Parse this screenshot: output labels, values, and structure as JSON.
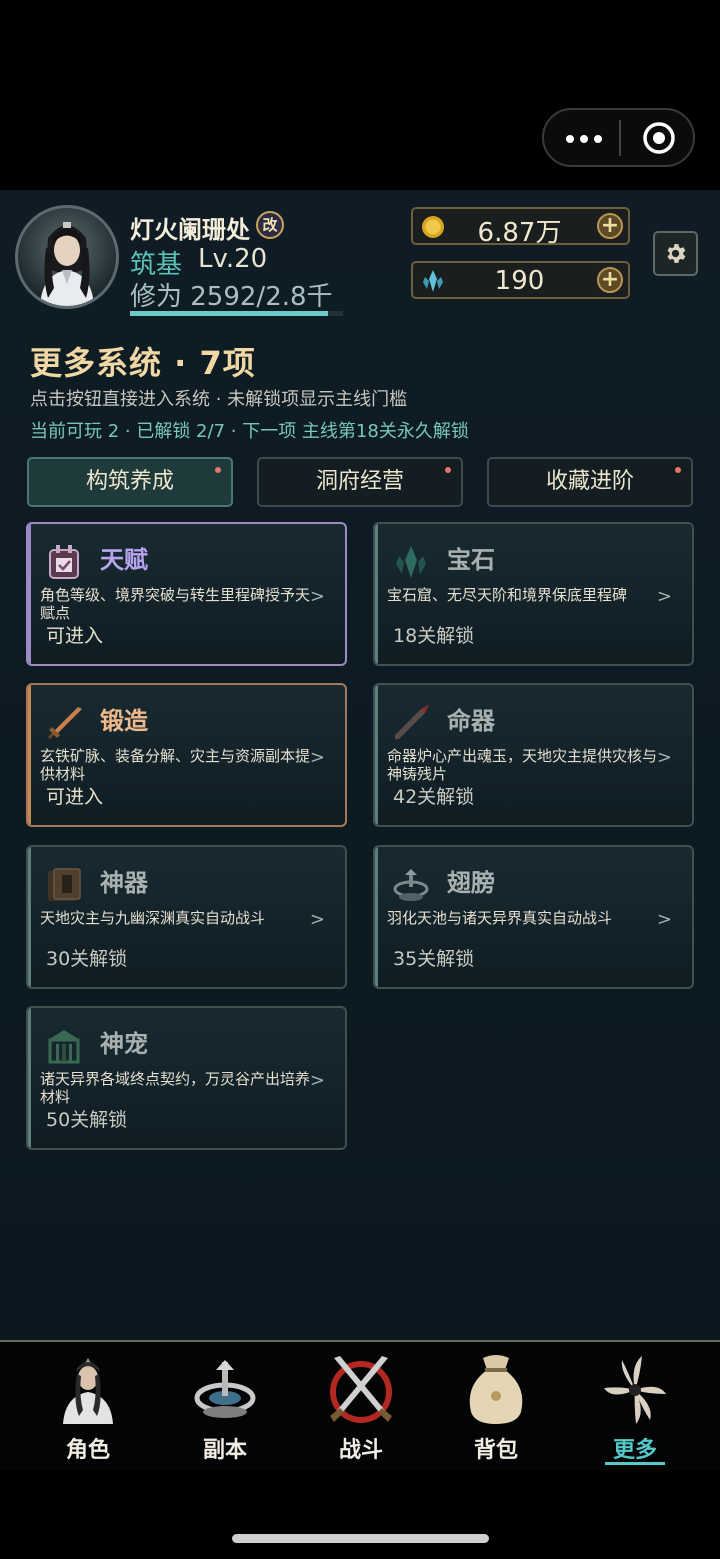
{
  "player": {
    "name": "灯火阑珊处",
    "rename_badge": "改",
    "realm": "筑基",
    "level": "Lv.20",
    "cultivation": "修为 2592/2.8千",
    "cultivation_progress": 0.93
  },
  "resources": {
    "gold": "6.87万",
    "spirit_crystal": "190",
    "plus": "+"
  },
  "header": {
    "title": "更多系统 · 7项",
    "subtitle": "点击按钮直接进入系统 · 未解锁项显示主线门槛",
    "status_line": "当前可玩 2 · 已解锁 2/7 · 下一项 主线第18关永久解锁"
  },
  "tabs": [
    {
      "label": "构筑养成",
      "active": true
    },
    {
      "label": "洞府经营",
      "active": false
    },
    {
      "label": "收藏进阶",
      "active": false
    }
  ],
  "cards": [
    {
      "name": "天赋",
      "desc": "角色等级、境界突破与转生里程碑授予天赋点",
      "status": "可进入",
      "icon": "talent-icon",
      "color": "#b8a4ef"
    },
    {
      "name": "宝石",
      "desc": "宝石窟、无尽天阶和境界保底里程碑",
      "status": "18关解锁",
      "icon": "gem-icon",
      "color": "#a9b1b0"
    },
    {
      "name": "锻造",
      "desc": "玄铁矿脉、装备分解、灾主与资源副本提供材料",
      "status": "可进入",
      "icon": "sword-icon",
      "color": "#f0b98c"
    },
    {
      "name": "命器",
      "desc": "命器炉心产出魂玉，天地灾主提供灾核与神铸残片",
      "status": "42关解锁",
      "icon": "spear-icon",
      "color": "#a9b1b0"
    },
    {
      "name": "神器",
      "desc": "天地灾主与九幽深渊真实自动战斗",
      "status": "30关解锁",
      "icon": "book-icon",
      "color": "#a9b1b0"
    },
    {
      "name": "翅膀",
      "desc": "羽化天池与诸天异界真实自动战斗",
      "status": "35关解锁",
      "icon": "altar-icon",
      "color": "#a9b1b0"
    },
    {
      "name": "神宠",
      "desc": "诸天异界各域终点契约，万灵谷产出培养材料",
      "status": "50关解锁",
      "icon": "shrine-icon",
      "color": "#a9b1b0"
    }
  ],
  "arrow": ">",
  "nav": [
    {
      "label": "角色",
      "icon": "character-icon",
      "active": false
    },
    {
      "label": "副本",
      "icon": "dungeon-icon",
      "active": false
    },
    {
      "label": "战斗",
      "icon": "battle-icon",
      "active": false
    },
    {
      "label": "背包",
      "icon": "bag-icon",
      "active": false
    },
    {
      "label": "更多",
      "icon": "more-icon",
      "active": true
    }
  ]
}
